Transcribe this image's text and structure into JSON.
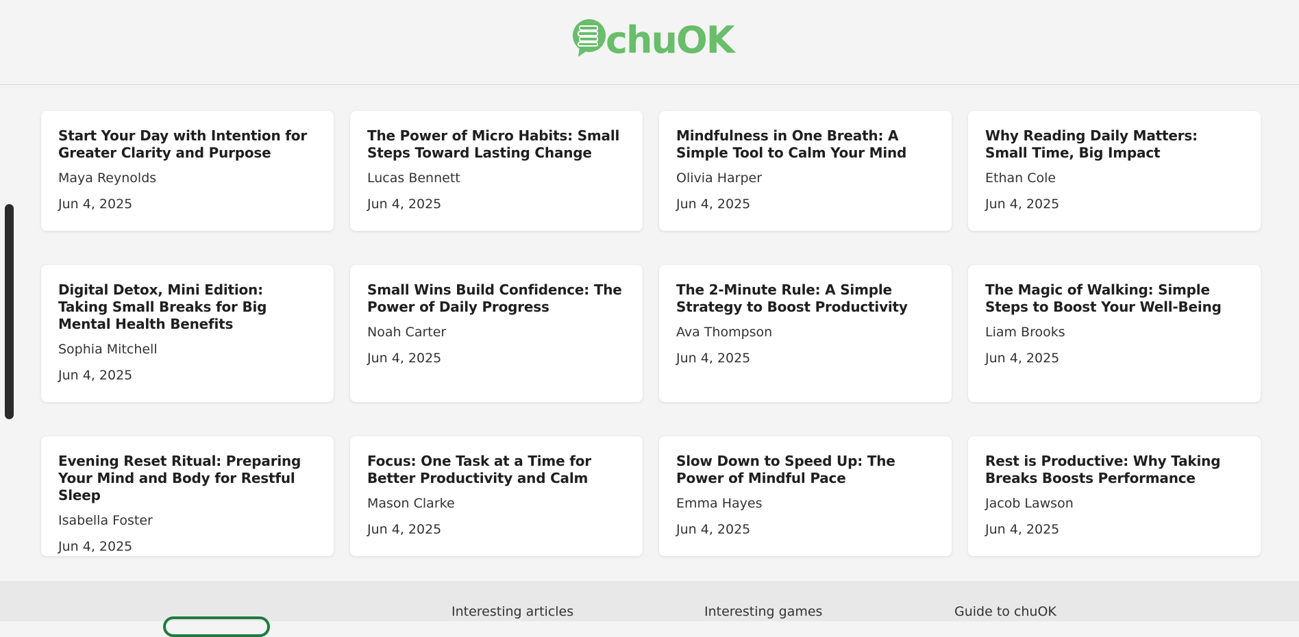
{
  "header": {
    "logo_text": "chuOK",
    "logo_color": "#69bd6b"
  },
  "articles": [
    {
      "title": "Start Your Day with Intention for Greater Clarity and Purpose",
      "author": "Maya Reynolds",
      "date": "Jun 4, 2025"
    },
    {
      "title": "The Power of Micro Habits: Small Steps Toward Lasting Change",
      "author": "Lucas Bennett",
      "date": "Jun 4, 2025"
    },
    {
      "title": "Mindfulness in One Breath: A Simple Tool to Calm Your Mind",
      "author": "Olivia Harper",
      "date": "Jun 4, 2025"
    },
    {
      "title": "Why Reading Daily Matters: Small Time, Big Impact",
      "author": "Ethan Cole",
      "date": "Jun 4, 2025"
    },
    {
      "title": "Digital Detox, Mini Edition: Taking Small Breaks for Big Mental Health Benefits",
      "author": "Sophia Mitchell",
      "date": "Jun 4, 2025"
    },
    {
      "title": "Small Wins Build Confidence: The Power of Daily Progress",
      "author": "Noah Carter",
      "date": "Jun 4, 2025"
    },
    {
      "title": "The 2-Minute Rule: A Simple Strategy to Boost Productivity",
      "author": "Ava Thompson",
      "date": "Jun 4, 2025"
    },
    {
      "title": "The Magic of Walking: Simple Steps to Boost Your Well-Being",
      "author": "Liam Brooks",
      "date": "Jun 4, 2025"
    },
    {
      "title": "Evening Reset Ritual: Preparing Your Mind and Body for Restful Sleep",
      "author": "Isabella Foster",
      "date": "Jun 4, 2025"
    },
    {
      "title": "Focus: One Task at a Time for Better Productivity and Calm",
      "author": "Mason Clarke",
      "date": "Jun 4, 2025"
    },
    {
      "title": "Slow Down to Speed Up: The Power of Mindful Pace",
      "author": "Emma Hayes",
      "date": "Jun 4, 2025"
    },
    {
      "title": "Rest is Productive: Why Taking Breaks Boosts Performance",
      "author": "Jacob Lawson",
      "date": "Jun 4, 2025"
    }
  ],
  "footer": {
    "links": [
      "Interesting articles",
      "Interesting games",
      "Guide to chuOK"
    ],
    "badge_color": "#1f7a3e"
  }
}
